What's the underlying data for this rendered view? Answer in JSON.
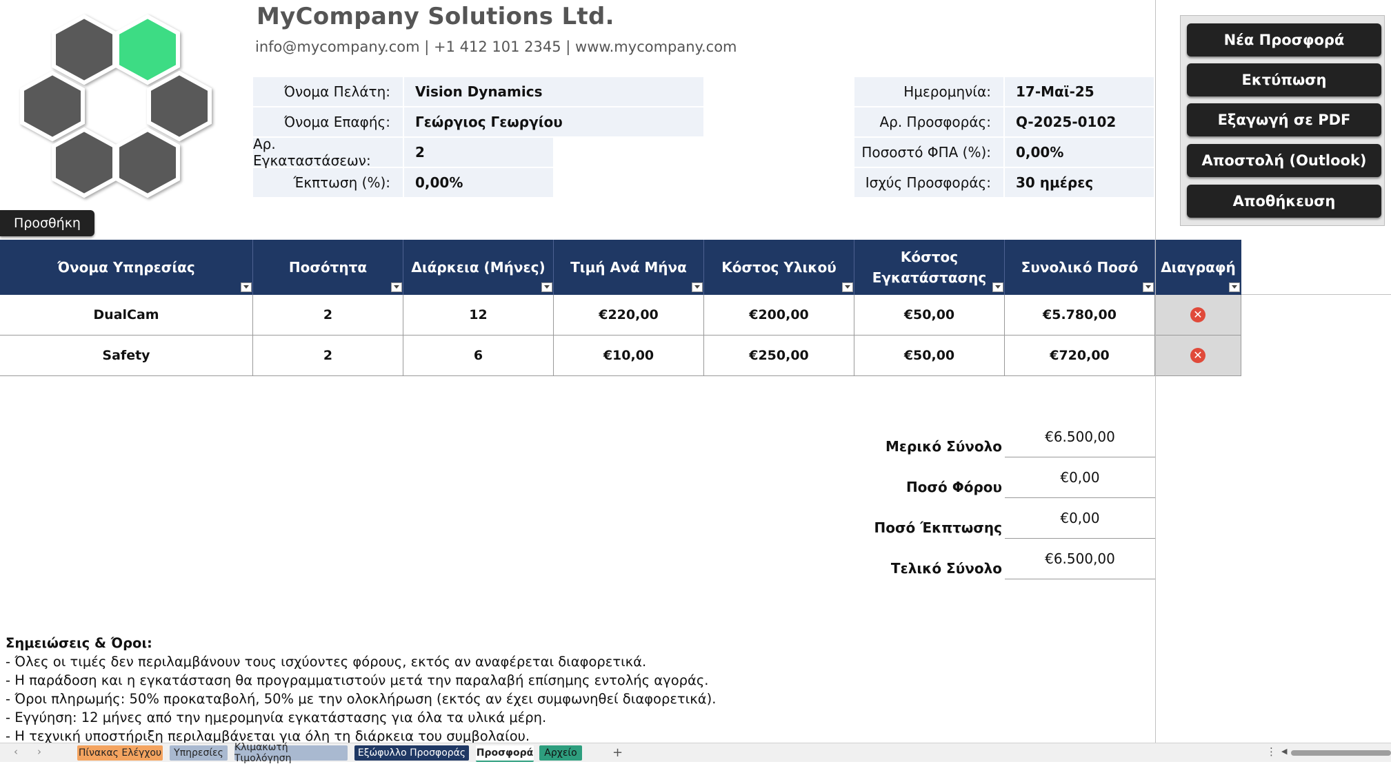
{
  "company": {
    "name": "MyCompany Solutions Ltd.",
    "contact": "info@mycompany.com | +1 412 101 2345 | www.mycompany.com"
  },
  "client_info": [
    {
      "label": "Όνομα Πελάτη:",
      "value": "Vision Dynamics"
    },
    {
      "label": "Όνομα Επαφής:",
      "value": "Γεώργιος Γεωργίου"
    },
    {
      "label": "Αρ. Εγκαταστάσεων:",
      "value": "2"
    },
    {
      "label": "Έκπτωση (%):",
      "value": "0,00%"
    }
  ],
  "quote_info": [
    {
      "label": "Ημερομηνία:",
      "value": "17-Μαϊ-25"
    },
    {
      "label": "Αρ. Προσφοράς:",
      "value": "Q-2025-0102"
    },
    {
      "label": "Ποσοστό ΦΠΑ (%):",
      "value": "0,00%"
    },
    {
      "label": "Ισχύς Προσφοράς:",
      "value": "30 ημέρες"
    }
  ],
  "add_button": "Προσθήκη",
  "table": {
    "headers": [
      "Όνομα Υπηρεσίας",
      "Ποσότητα",
      "Διάρκεια (Μήνες)",
      "Τιμή Ανά Μήνα",
      "Κόστος Υλικού",
      "Κόστος Εγκατάστασης",
      "Συνολικό Ποσό",
      "Διαγραφή"
    ],
    "rows": [
      [
        "DualCam",
        "2",
        "12",
        "€220,00",
        "€200,00",
        "€50,00",
        "€5.780,00"
      ],
      [
        "Safety",
        "2",
        "6",
        "€10,00",
        "€250,00",
        "€50,00",
        "€720,00"
      ]
    ]
  },
  "totals": [
    {
      "label": "Μερικό Σύνολο",
      "value": "€6.500,00"
    },
    {
      "label": "Ποσό Φόρου",
      "value": "€0,00"
    },
    {
      "label": "Ποσό Έκπτωσης",
      "value": "€0,00"
    },
    {
      "label": "Τελικό Σύνολο",
      "value": "€6.500,00"
    }
  ],
  "notes": {
    "title": "Σημειώσεις & Όροι:",
    "lines": [
      "- Όλες οι τιμές δεν περιλαμβάνουν τους ισχύοντες φόρους, εκτός αν αναφέρεται διαφορετικά.",
      "- Η παράδοση και η εγκατάσταση θα προγραμματιστούν μετά την παραλαβή επίσημης εντολής αγοράς.",
      "- Όροι πληρωμής: 50% προκαταβολή, 50% με την ολοκλήρωση (εκτός αν έχει συμφωνηθεί διαφορετικά).",
      "- Εγγύηση: 12 μήνες από την ημερομηνία εγκατάστασης για όλα τα υλικά μέρη.",
      "- Η τεχνική υποστήριξη περιλαμβάνεται για όλη τη διάρκεια του συμβολαίου."
    ]
  },
  "actions": [
    "Νέα Προσφορά",
    "Εκτύπωση",
    "Εξαγωγή σε PDF",
    "Αποστολή (Outlook)",
    "Αποθήκευση"
  ],
  "sheet_tabs": [
    {
      "label": "Πίνακας Ελέγχου",
      "color": "#f4a460"
    },
    {
      "label": "Υπηρεσίες",
      "color": "#a9b9d0"
    },
    {
      "label": "Κλιμακωτή Τιμολόγηση",
      "color": "#a9b9d0"
    },
    {
      "label": "Εξώφυλλο Προσφοράς",
      "color": "#1f3864"
    },
    {
      "label": "Προσφορά",
      "color": "#ffffff"
    },
    {
      "label": "Αρχείο",
      "color": "#2e9e7e"
    }
  ],
  "colors": {
    "header_blue": "#1f3864",
    "logo_green": "#3ddc84",
    "logo_gray": "#595959",
    "delete_red": "#e04a3a"
  },
  "icons": {
    "delete": "close-circle-icon",
    "add_sheet": "plus-icon"
  }
}
